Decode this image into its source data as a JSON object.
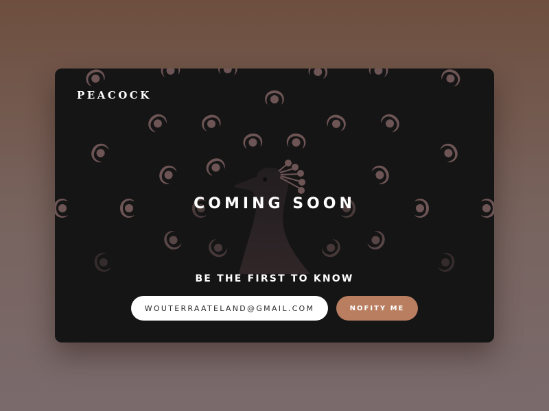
{
  "brand": {
    "name": "PEACOCK"
  },
  "hero": {
    "headline": "COMING SOON"
  },
  "signup": {
    "tagline": "BE THE FIRST TO KNOW",
    "email_value": "WOUTERRAATELAND@GMAIL.COM",
    "button_label": "NOFITY ME"
  },
  "colors": {
    "page_background": "#6e4f3f",
    "card_background": "#161516",
    "feather_eye": "#6e5555",
    "button_accent": "#b97e60",
    "text": "#ffffff"
  },
  "icons": {
    "illustration": "peacock-illustration",
    "feathers": "peacock-feather-eye-icon"
  }
}
